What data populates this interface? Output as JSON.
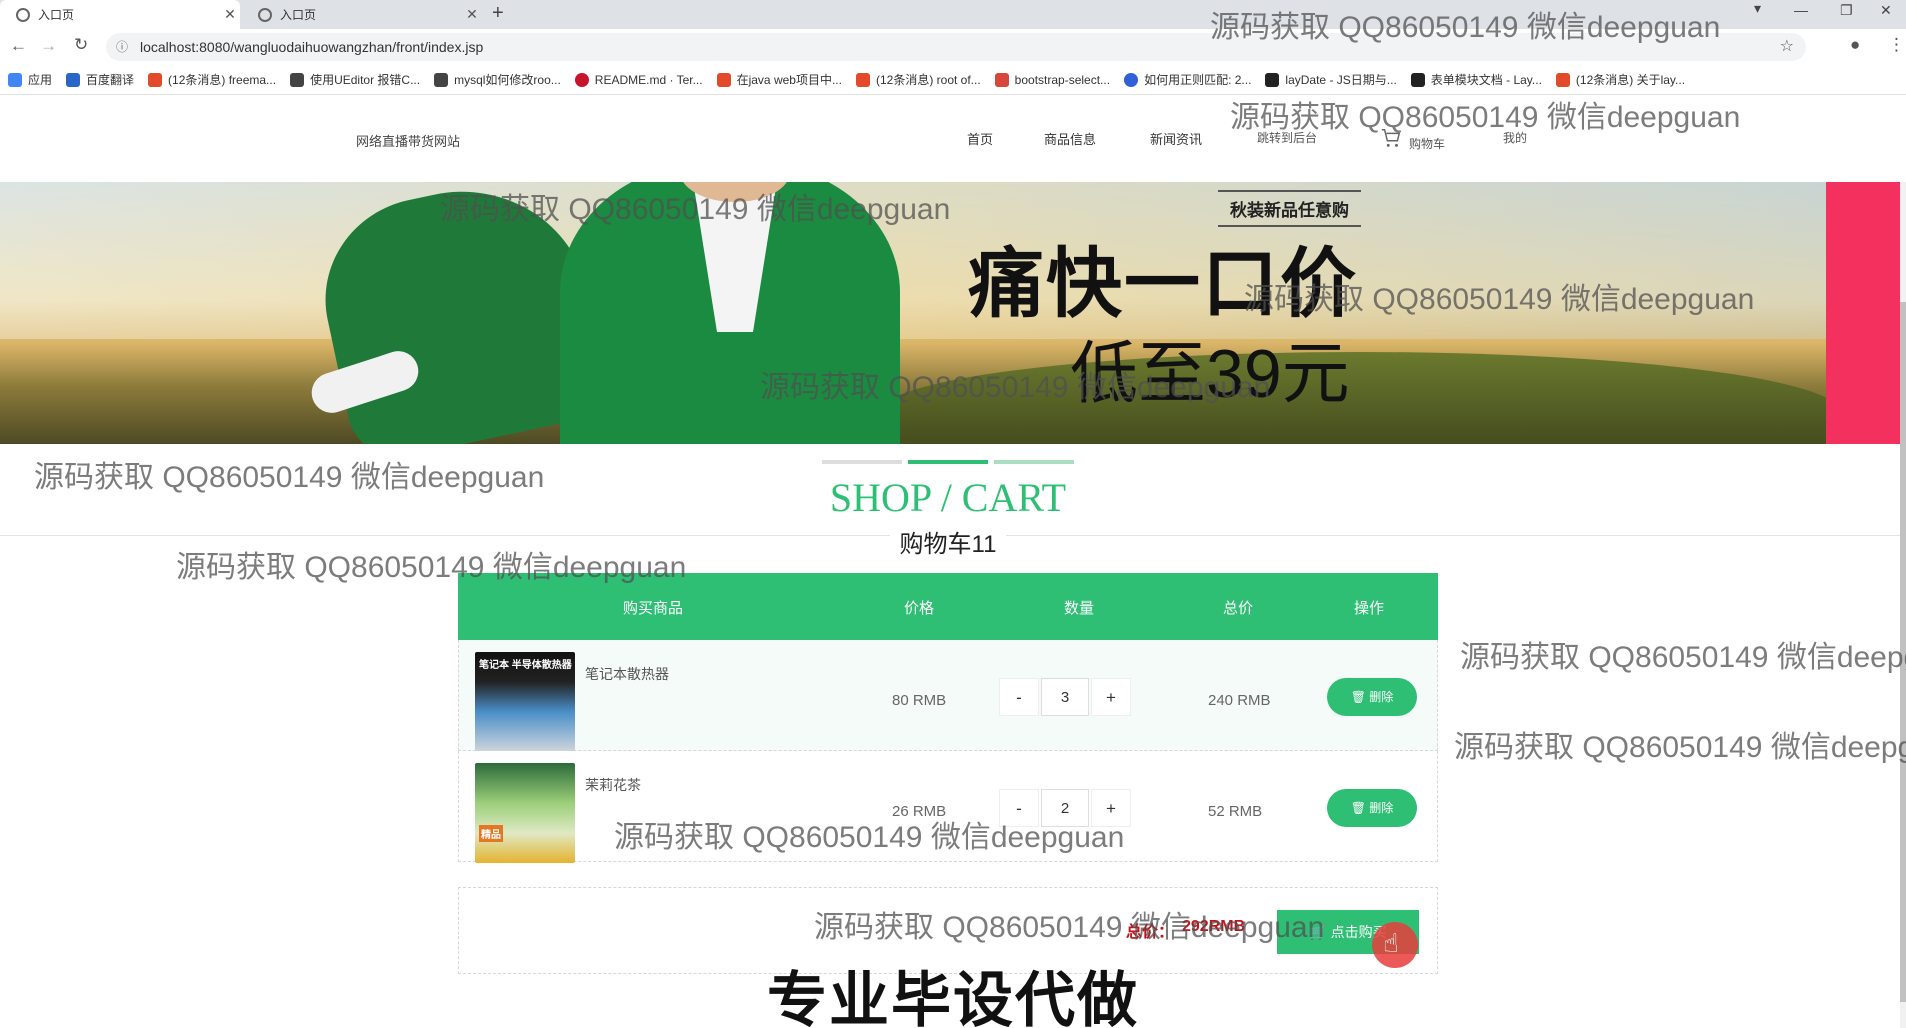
{
  "browser": {
    "tabs": [
      {
        "label": "入口页"
      },
      {
        "label": "入口页"
      }
    ],
    "url": "localhost:8080/wangluodaihuowangzhan/front/index.jsp",
    "bookmarks": [
      {
        "label": "应用",
        "color": "#4285f4"
      },
      {
        "label": "百度翻译",
        "color": "#2a66c8"
      },
      {
        "label": "(12条消息) freema...",
        "color": "#e24a2a"
      },
      {
        "label": "使用UEditor 报错C...",
        "color": "#444"
      },
      {
        "label": "mysql如何修改roo...",
        "color": "#444"
      },
      {
        "label": "README.md · Ter...",
        "color": "#c7162b"
      },
      {
        "label": "在java web项目中...",
        "color": "#e24a2a"
      },
      {
        "label": "(12条消息) root of...",
        "color": "#e24a2a"
      },
      {
        "label": "bootstrap-select...",
        "color": "#d8483a"
      },
      {
        "label": "如何用正则匹配: 2...",
        "color": "#3060d8"
      },
      {
        "label": "layDate - JS日期与...",
        "color": "#222"
      },
      {
        "label": "表单模块文档 - Lay...",
        "color": "#222"
      },
      {
        "label": "(12条消息) 关于lay...",
        "color": "#e24a2a"
      }
    ]
  },
  "site": {
    "name": "网络直播带货网站",
    "menu": [
      "首页",
      "商品信息",
      "新闻资讯",
      "跳转到后台",
      "购物车",
      "我的"
    ]
  },
  "banner": {
    "promo_small": "秋装新品任意购",
    "promo_big": "痛快一口价",
    "promo_price": "低至39元"
  },
  "section": {
    "title": "SHOP / CART",
    "subtitle": "购物车11"
  },
  "cart": {
    "headers": [
      "购买商品",
      "价格",
      "数量",
      "总价",
      "操作"
    ],
    "items": [
      {
        "name": "笔记本散热器",
        "price": "80 RMB",
        "qty": "3",
        "total": "240 RMB",
        "delete": "删除",
        "minus": "-",
        "plus": "+",
        "thumb_text": "笔记本 半导体散热器"
      },
      {
        "name": "茉莉花茶",
        "price": "26 RMB",
        "qty": "2",
        "total": "52 RMB",
        "delete": "删除",
        "minus": "-",
        "plus": "+",
        "thumb_text": "精品"
      }
    ],
    "sum_label": "总价：",
    "sum_value": "292RMB",
    "buy_label": "点击购买"
  },
  "overlay": {
    "watermark": "源码获取 QQ86050149 微信deepguan",
    "footer": "专业毕设代做"
  },
  "colors": {
    "accent": "#2fbf74",
    "price_red": "#c3121a",
    "banner_pink": "#f4305f"
  }
}
